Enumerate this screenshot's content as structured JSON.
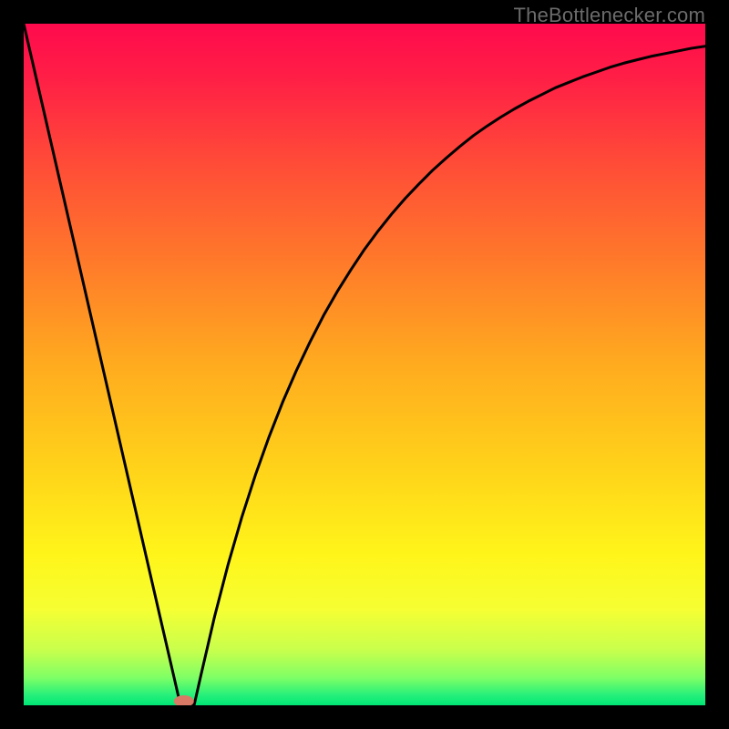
{
  "watermark": {
    "text": "TheBottlenecker.com"
  },
  "chart_data": {
    "type": "line",
    "title": "",
    "xlabel": "",
    "ylabel": "",
    "xlim": [
      0,
      100
    ],
    "ylim": [
      0,
      100
    ],
    "x": [
      0,
      2,
      4,
      6,
      8,
      10,
      12,
      14,
      16,
      18,
      20,
      22,
      23,
      24,
      25,
      26,
      28,
      30,
      32,
      34,
      36,
      38,
      40,
      42,
      44,
      46,
      48,
      50,
      52,
      54,
      56,
      58,
      60,
      62,
      64,
      66,
      68,
      70,
      72,
      74,
      76,
      78,
      80,
      82,
      84,
      86,
      88,
      90,
      92,
      94,
      96,
      98,
      100
    ],
    "y": [
      100,
      91.3,
      82.6,
      73.9,
      65.2,
      56.5,
      47.8,
      39.1,
      30.4,
      21.7,
      13.0,
      4.35,
      0,
      0,
      0,
      4.4,
      13.0,
      20.7,
      27.6,
      33.8,
      39.4,
      44.5,
      49.1,
      53.3,
      57.2,
      60.7,
      63.9,
      66.9,
      69.6,
      72.1,
      74.4,
      76.5,
      78.5,
      80.3,
      82.0,
      83.6,
      85.0,
      86.3,
      87.5,
      88.6,
      89.6,
      90.6,
      91.4,
      92.2,
      92.9,
      93.6,
      94.2,
      94.7,
      95.2,
      95.6,
      96.0,
      96.4,
      96.7
    ],
    "marker": {
      "x": 23.5,
      "y": 0.6
    },
    "gradient_stops": [
      {
        "offset": 0.0,
        "color": "#ff0a4d"
      },
      {
        "offset": 0.08,
        "color": "#ff1f46"
      },
      {
        "offset": 0.2,
        "color": "#ff4a38"
      },
      {
        "offset": 0.35,
        "color": "#ff7a2a"
      },
      {
        "offset": 0.5,
        "color": "#ffab1f"
      },
      {
        "offset": 0.65,
        "color": "#ffd21a"
      },
      {
        "offset": 0.78,
        "color": "#fff51a"
      },
      {
        "offset": 0.86,
        "color": "#f5ff33"
      },
      {
        "offset": 0.92,
        "color": "#c7ff4d"
      },
      {
        "offset": 0.96,
        "color": "#7dff66"
      },
      {
        "offset": 0.985,
        "color": "#26f07a"
      },
      {
        "offset": 1.0,
        "color": "#00e676"
      }
    ]
  }
}
